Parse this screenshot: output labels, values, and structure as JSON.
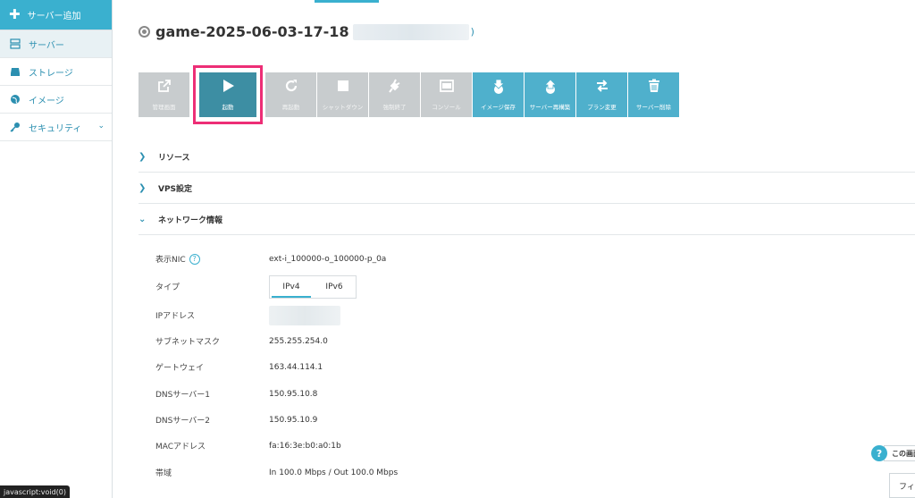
{
  "sidebar": {
    "add_label": "サーバー追加",
    "items": [
      {
        "label": "サーバー",
        "icon": "server-icon"
      },
      {
        "label": "ストレージ",
        "icon": "storage-icon"
      },
      {
        "label": "イメージ",
        "icon": "globe-icon"
      },
      {
        "label": "セキュリティ",
        "icon": "key-icon"
      }
    ]
  },
  "header": {
    "title": "game-2025-06-03-17-18",
    "title_suffix": ")"
  },
  "toolbar": {
    "buttons": [
      {
        "label": "管理画面",
        "icon": "external-link-icon",
        "enabled": false
      },
      {
        "label": "起動",
        "icon": "play-icon",
        "enabled": true
      },
      {
        "label": "再起動",
        "icon": "refresh-icon",
        "enabled": false
      },
      {
        "label": "シャットダウン",
        "icon": "stop-icon",
        "enabled": false
      },
      {
        "label": "強制終了",
        "icon": "plug-icon",
        "enabled": false
      },
      {
        "label": "コンソール",
        "icon": "console-icon",
        "enabled": false
      },
      {
        "label": "イメージ保存",
        "icon": "download-icon",
        "enabled": true
      },
      {
        "label": "サーバー再構築",
        "icon": "rebuild-icon",
        "enabled": true
      },
      {
        "label": "プラン変更",
        "icon": "swap-icon",
        "enabled": true
      },
      {
        "label": "サーバー削除",
        "icon": "trash-icon",
        "enabled": true
      }
    ]
  },
  "sections": {
    "resource": "リソース",
    "vps": "VPS設定",
    "network": "ネットワーク情報"
  },
  "network": {
    "nic_label": "表示NIC",
    "nic_value": "ext-i_100000-o_100000-p_0a",
    "type_label": "タイプ",
    "type_tabs": [
      "IPv4",
      "IPv6"
    ],
    "ip_label": "IPアドレス",
    "subnet_label": "サブネットマスク",
    "subnet_value": "255.255.254.0",
    "gateway_label": "ゲートウェイ",
    "gateway_value": "163.44.114.1",
    "dns1_label": "DNSサーバー1",
    "dns1_value": "150.95.10.8",
    "dns2_label": "DNSサーバー2",
    "dns2_value": "150.95.10.9",
    "mac_label": "MACアドレス",
    "mac_value": "fa:16:3e:b0:a0:1b",
    "bandwidth_label": "帯域",
    "bandwidth_value": "In 100.0 Mbps / Out 100.0 Mbps"
  },
  "status_bar": "javascript:void(0)",
  "help_widget": {
    "icon": "?",
    "label": "この画面"
  },
  "feedback_label": "フィ"
}
